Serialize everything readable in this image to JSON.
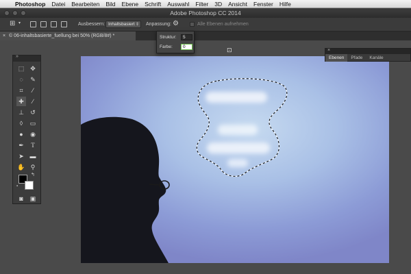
{
  "menubar": {
    "app_name": "Photoshop",
    "items": [
      "Datei",
      "Bearbeiten",
      "Bild",
      "Ebene",
      "Schrift",
      "Auswahl",
      "Filter",
      "3D",
      "Ansicht",
      "Fenster",
      "Hilfe"
    ]
  },
  "window": {
    "title": "Adobe Photoshop CC 2014"
  },
  "options": {
    "ausbessern_label": "Ausbessern:",
    "ausbessern_value": "Inhaltsbasiert",
    "anpassung_label": "Anpassung:",
    "all_layers_label": "Alle Ebenen aufnehmen"
  },
  "popup": {
    "struktur_label": "Struktur:",
    "struktur_value": "5",
    "farbe_label": "Farbe:",
    "farbe_value": "0"
  },
  "document_tab": {
    "close": "×",
    "title": "06-inhaltsbasierte_fuellung bei 50% (RGB/8#) *"
  },
  "panel": {
    "close": "×",
    "tabs": [
      "Ebenen",
      "Pfade",
      "Kanäle"
    ]
  },
  "colors": {
    "accent": "#6fc04e",
    "ui_dark": "#3b3b3b",
    "canvas_sky": "#a9c0e6"
  }
}
